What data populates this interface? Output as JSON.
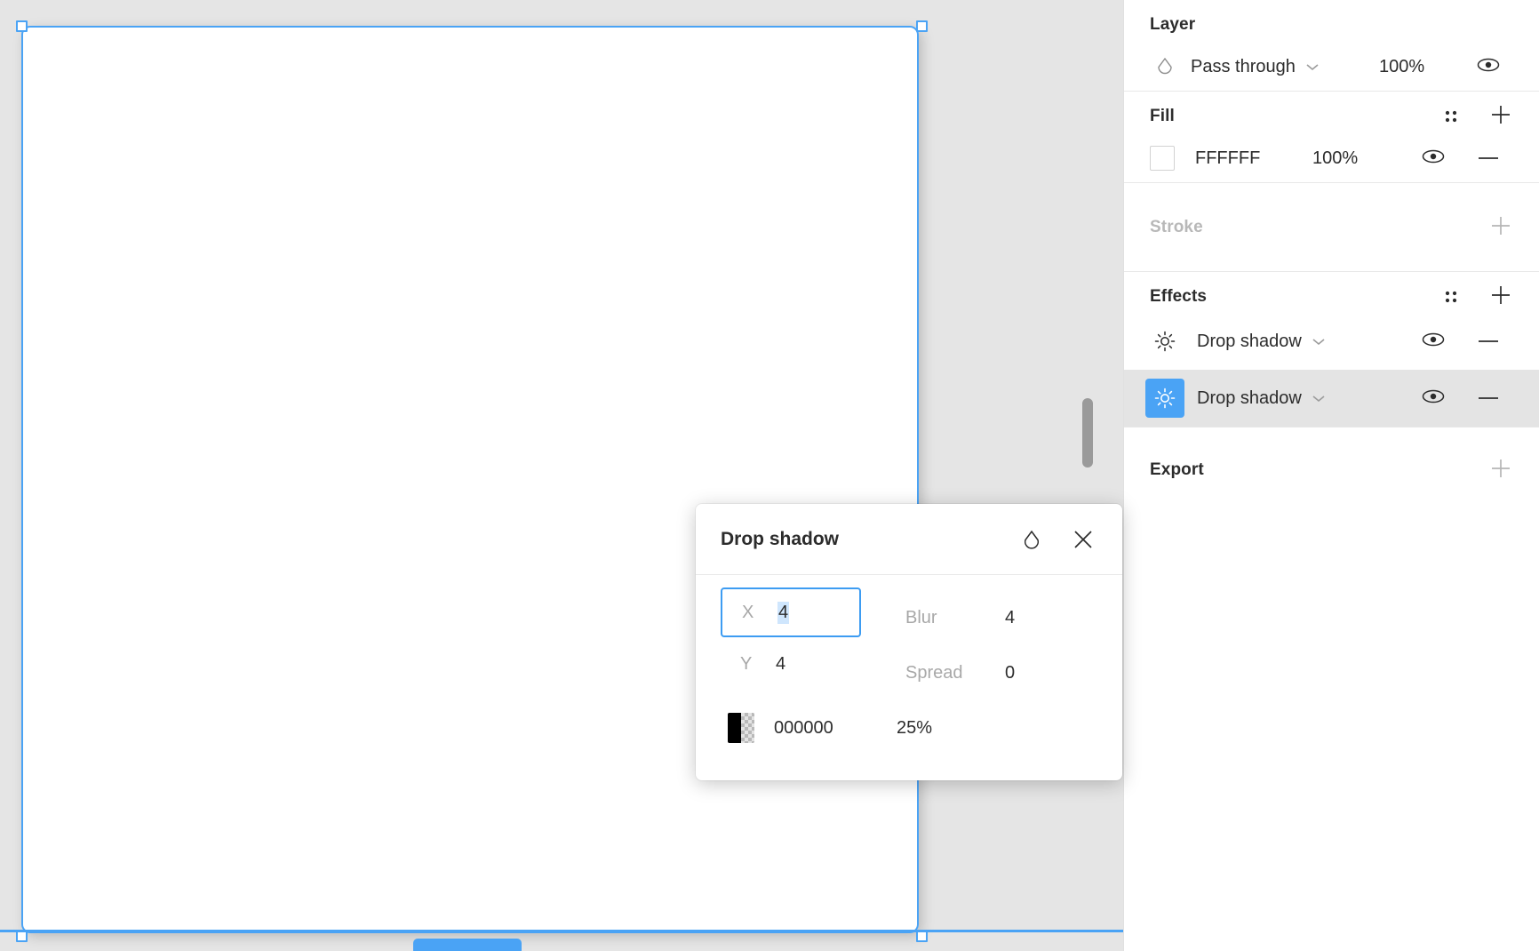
{
  "canvas": {
    "frame_fill": "#FFFFFF",
    "selection_color": "#4AA3F5",
    "background": "#E5E5E5"
  },
  "panel": {
    "layer": {
      "title": "Layer",
      "blend_mode": "Pass through",
      "opacity": "100%",
      "blend_icon": "droplet-icon",
      "chevron_icon": "chevron-down-icon",
      "visibility_icon": "eye-icon"
    },
    "fill": {
      "title": "Fill",
      "grid_icon": "grid-dots-icon",
      "add_icon": "plus-icon",
      "items": [
        {
          "swatch": "#FFFFFF",
          "hex": "FFFFFF",
          "opacity": "100%",
          "visibility_icon": "eye-icon",
          "remove_icon": "minus-icon"
        }
      ]
    },
    "stroke": {
      "title": "Stroke",
      "add_icon": "plus-icon"
    },
    "effects": {
      "title": "Effects",
      "grid_icon": "grid-dots-icon",
      "add_icon": "plus-icon",
      "items": [
        {
          "icon": "sun-effect-icon",
          "label": "Drop shadow",
          "chevron_icon": "chevron-down-icon",
          "visibility_icon": "eye-icon",
          "remove_icon": "minus-icon",
          "selected": false
        },
        {
          "icon": "sun-effect-icon",
          "label": "Drop shadow",
          "chevron_icon": "chevron-down-icon",
          "visibility_icon": "eye-icon",
          "remove_icon": "minus-icon",
          "selected": true
        }
      ]
    },
    "export": {
      "title": "Export",
      "add_icon": "plus-icon"
    }
  },
  "dialog": {
    "title": "Drop shadow",
    "blend_icon": "droplet-icon",
    "close_icon": "close-icon",
    "x_label": "X",
    "x_value": "4",
    "y_label": "Y",
    "y_value": "4",
    "blur_label": "Blur",
    "blur_value": "4",
    "spread_label": "Spread",
    "spread_value": "0",
    "color_hex": "000000",
    "color_opacity": "25%",
    "focus_color": "#3D9CF2",
    "selection_highlight": "#CFE6FD"
  }
}
